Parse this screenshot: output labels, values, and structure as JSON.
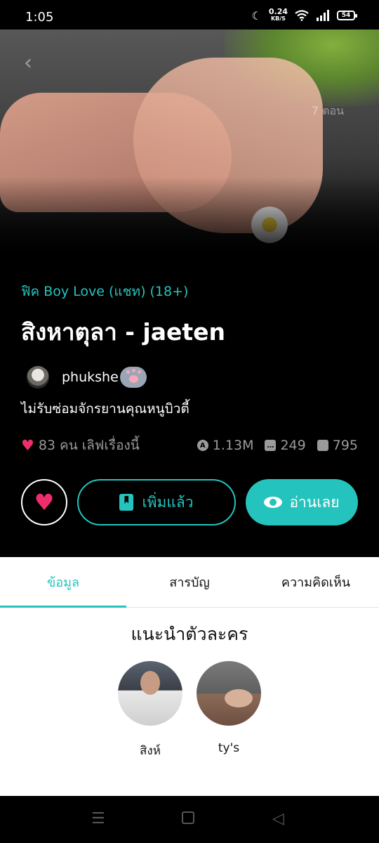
{
  "status_bar": {
    "time": "1:05",
    "speed_value": "0.24",
    "speed_unit": "KB/S",
    "battery": "54"
  },
  "cover": {
    "episodes": "7 ตอน"
  },
  "story": {
    "category": "ฟิค Boy Love (แชท)  (18+)",
    "title": "สิงหาตุลา - jaeten",
    "author": "phukshe",
    "description": "ไม่รับซ่อมจักรยานคุณหนูบิวตี้",
    "likes_text": "83 คน เลิฟเรื่องนี้",
    "views": "1.13M",
    "comments": "249",
    "bookmarks": "795"
  },
  "actions": {
    "added_label": "เพิ่มแล้ว",
    "read_label": "อ่านเลย"
  },
  "tabs": [
    {
      "label": "ข้อมูล",
      "active": true
    },
    {
      "label": "สารบัญ",
      "active": false
    },
    {
      "label": "ความคิดเห็น",
      "active": false
    }
  ],
  "characters": {
    "section_title": "แนะนำตัวละคร",
    "items": [
      {
        "name": "สิงห์"
      },
      {
        "name": "ty's"
      }
    ]
  },
  "colors": {
    "accent": "#25c3bd",
    "heart": "#ec2f6b"
  },
  "icons": {
    "back": "chevron-left-icon",
    "like": "heart-icon",
    "views": "view-count-icon",
    "comments": "comment-icon",
    "bookmarks": "bookmark-icon",
    "read": "eye-icon"
  }
}
